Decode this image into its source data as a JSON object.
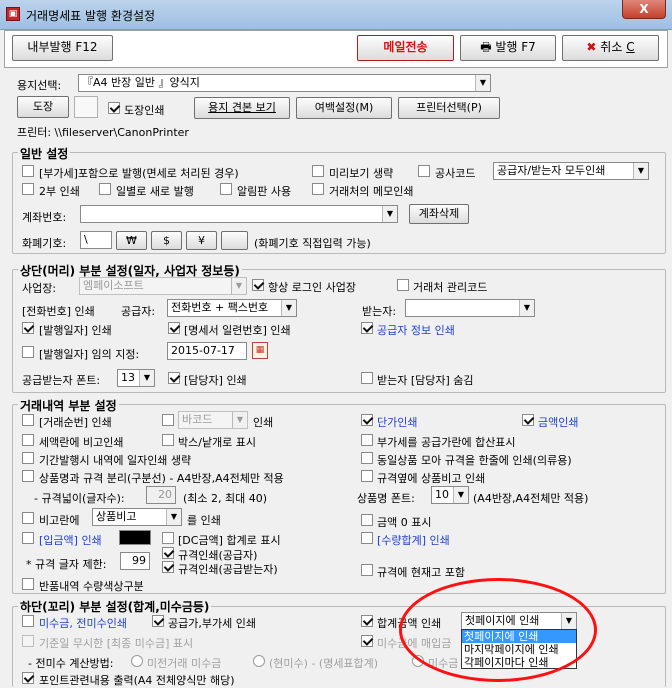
{
  "window": {
    "title": "거래명세표 발행 환경설정",
    "close": "X"
  },
  "toolbar": {
    "internal_issue": "내부발행 F12",
    "send_email": "메일전송",
    "issue": "발행 F7",
    "cancel_prefix": "취소",
    "cancel_key": "C"
  },
  "paper": {
    "label": "용지선택:",
    "selected": "『A4 반장 일반 』양식지",
    "stamp_btn": "도장",
    "stamp_print": "도장인쇄",
    "preview": "용지 견본 보기",
    "margin": "여백설정(M)",
    "printer_select": "프린터선택(P)",
    "printer_text": "프린터: \\\\fileserver\\CanonPrinter"
  },
  "general": {
    "title": "일반 설정",
    "vat_included": "[부가세]포함으로 발행(면세로 처리된 경우)",
    "preview_skip": "미리보기 생략",
    "construction_code": "공사코드",
    "both_print_option": "공급자/받는자 모두인쇄",
    "two_copies": "2부 인쇄",
    "date_new_issue": "일별로 새로 발행",
    "notice_board": "알림판 사용",
    "client_memo": "거래처의 메모인쇄",
    "account_label": "계좌번호:",
    "account_delete": "계좌삭제",
    "currency_label": "화폐기호:",
    "currency_value": "\\",
    "currency_opts": [
      "₩",
      "$",
      "¥",
      ""
    ],
    "currency_note": "(화폐기호 직접입력 가능)"
  },
  "header": {
    "title": "상단(머리) 부분 설정(일자, 사업자 정보등)",
    "business_label": "사업장:",
    "business_value": "엠페이소프트",
    "always_login": "항상 로그인 사업장",
    "client_manage_code": "거래처 관리코드",
    "phone_print": "[전화번호] 인쇄",
    "supplier_label": "공급자:",
    "supplier_value": "전화번호 + 팩스번호",
    "receiver_label": "받는자:",
    "receiver_value": "",
    "issue_date_print": "[발행일자] 인쇄",
    "serial_print": "[명세서 일련번호] 인쇄",
    "supplier_info_print": "공급자 정보 인쇄",
    "issue_date_set": "[발행일자] 임의 지정:",
    "issue_date_value": "2015-07-17",
    "receiver_font_label": "공급받는자 폰트:",
    "receiver_font_value": "13",
    "manager_print": "[담당자] 인쇄",
    "receiver_manager_hide": "받는자 [담당자] 숨김"
  },
  "trade": {
    "title": "거래내역 부분 설정",
    "trade_order_print": "[거래순번] 인쇄",
    "barcode_value": "바코드",
    "barcode_print": "인쇄",
    "unit_price_print": "단가인쇄",
    "amount_print": "금액인쇄",
    "tax_compare": "세액란에 비고인쇄",
    "box_each": "박스/낱개로 표시",
    "vat_sum": "부가세를 공급가란에 합산표시",
    "period_skip": "기간발행시 내역에 일자인쇄 생략",
    "same_product": "동일상품 모아 규격을 한줄에 인쇄(의류용)",
    "spec_split": "상품명과 규격 분리(구분선) - A4반장,A4전체만 적용",
    "spec_beside": "규격옆에 상품비고 인쇄",
    "spec_width_label": "- 규격넓이(글자수):",
    "spec_width_value": "20",
    "spec_width_note": "(최소 2, 최대 40)",
    "product_font_label": "상품명 폰트:",
    "product_font_value": "10",
    "product_font_note": "(A4반장,A4전체만 적용)",
    "remark_label": "비고란에",
    "remark_value": "상품비고",
    "remark_suffix": "를 인쇄",
    "zero_amount": "금액 0 표시",
    "deposit_print": "[입금액] 인쇄",
    "dc_amount": "[DC금액] 합계로 표시",
    "qty_total_print": "[수량합계] 인쇄",
    "spec_limit_label": "* 규격 글자 제한:",
    "spec_limit_value": "99",
    "spec_print_supplier": "규격인쇄(공급자)",
    "spec_print_receiver": "규격인쇄(공급받는자)",
    "spec_stock": "규격에 현재고 포함",
    "return_qty": "반품내역 수량색상구분"
  },
  "footer": {
    "title": "하단(꼬리) 부분 설정(합계,미수금등)",
    "unpaid_print": "미수금, 전미수인쇄",
    "supply_vat_print": "공급가,부가세 인쇄",
    "total_print": "합계금액 인쇄",
    "total_select": "첫페이지에 인쇄",
    "base_date_ignore": "기준일 무시한 [최종 미수금] 표시",
    "unpaid_issue": "미수금에 매입금",
    "prev_unpaid_method": "- 전미수 계산방법:",
    "radio_prev": "미전거래 미수금",
    "radio_current": "(현미수) - (명세표합계)",
    "radio_other": "미수금",
    "points_print": "포인트관련내용 출력(A4 전체양식만 해당)",
    "dropdown_options": [
      "첫페이지에 인쇄",
      "마지막페이지에 인쇄",
      "각페이지마다 인쇄"
    ]
  }
}
